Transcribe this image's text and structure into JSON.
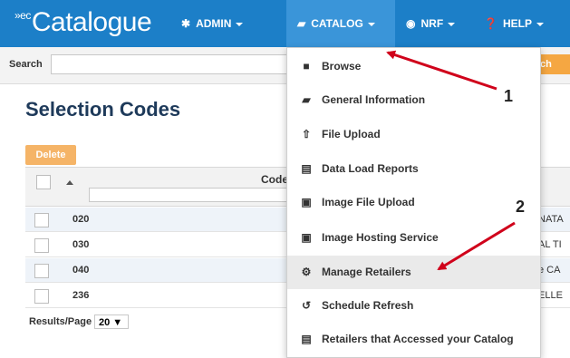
{
  "navbar": {
    "logo_prefix": "»ec",
    "logo_text": "Catalogue",
    "items": [
      {
        "label": "ADMIN",
        "icon": "gear-icon"
      },
      {
        "label": "CATALOG",
        "icon": "book-icon"
      },
      {
        "label": "NRF",
        "icon": "globe-icon"
      },
      {
        "label": "HELP",
        "icon": "help-icon"
      }
    ]
  },
  "search": {
    "label": "Search",
    "value": "",
    "button_label": "ch"
  },
  "page": {
    "title": "Selection Codes",
    "delete_label": "Delete"
  },
  "table": {
    "code_header": "Code",
    "rows": [
      {
        "code": "020",
        "name": "NATA"
      },
      {
        "code": "030",
        "name": "AL TI"
      },
      {
        "code": "040",
        "name": "e CA"
      },
      {
        "code": "236",
        "name": "ELLE"
      }
    ]
  },
  "pager": {
    "label": "Results/Page",
    "value": "20 ▼"
  },
  "catalog_menu": {
    "items": [
      {
        "label": "Browse",
        "icon": "folder-icon"
      },
      {
        "label": "General Information",
        "icon": "book-icon"
      },
      {
        "label": "File Upload",
        "icon": "upload-icon"
      },
      {
        "label": "Data Load Reports",
        "icon": "document-icon"
      },
      {
        "label": "Image File Upload",
        "icon": "image-icon"
      },
      {
        "label": "Image Hosting Service",
        "icon": "image-icon"
      },
      {
        "label": "Manage Retailers",
        "icon": "gears-icon"
      },
      {
        "label": "Schedule Refresh",
        "icon": "refresh-icon"
      },
      {
        "label": "Retailers that Accessed your Catalog",
        "icon": "document-icon"
      }
    ]
  },
  "callouts": {
    "one": "1",
    "two": "2"
  },
  "colors": {
    "navbar": "#1c7fc8",
    "active_tab": "#3a95d9",
    "accent_orange": "#f5a742",
    "arrow": "#d0021b"
  }
}
